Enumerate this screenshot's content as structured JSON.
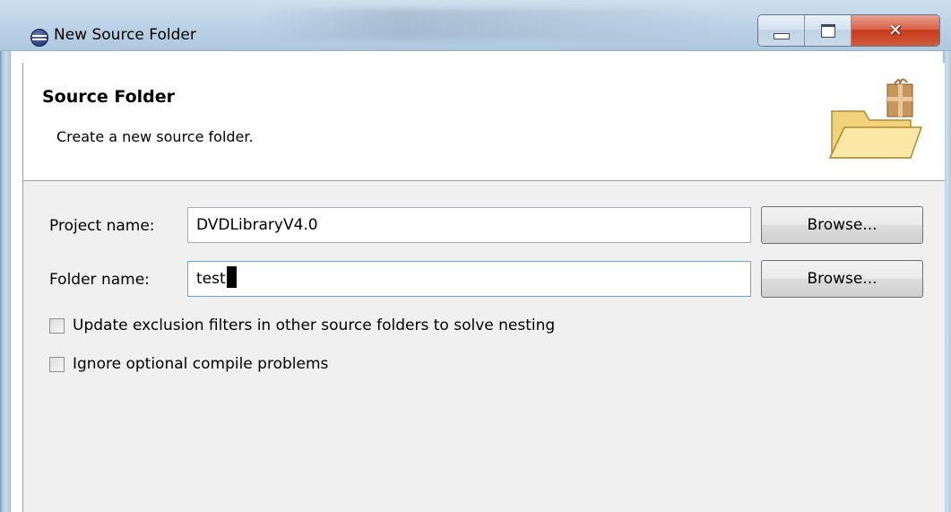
{
  "window": {
    "title": "New Source Folder",
    "icon": "eclipse-icon"
  },
  "banner": {
    "title": "Source Folder",
    "description": "Create a new source folder.",
    "image": "folder-package-icon"
  },
  "form": {
    "project": {
      "label": "Project name:",
      "value": "DVDLibraryV4.0",
      "browse_label": "Browse..."
    },
    "folder": {
      "label": "Folder name:",
      "value": "test",
      "browse_label": "Browse..."
    },
    "options": [
      {
        "label": "Update exclusion filters in other source folders to solve nesting",
        "checked": false
      },
      {
        "label": "Ignore optional compile problems",
        "checked": false
      }
    ]
  }
}
